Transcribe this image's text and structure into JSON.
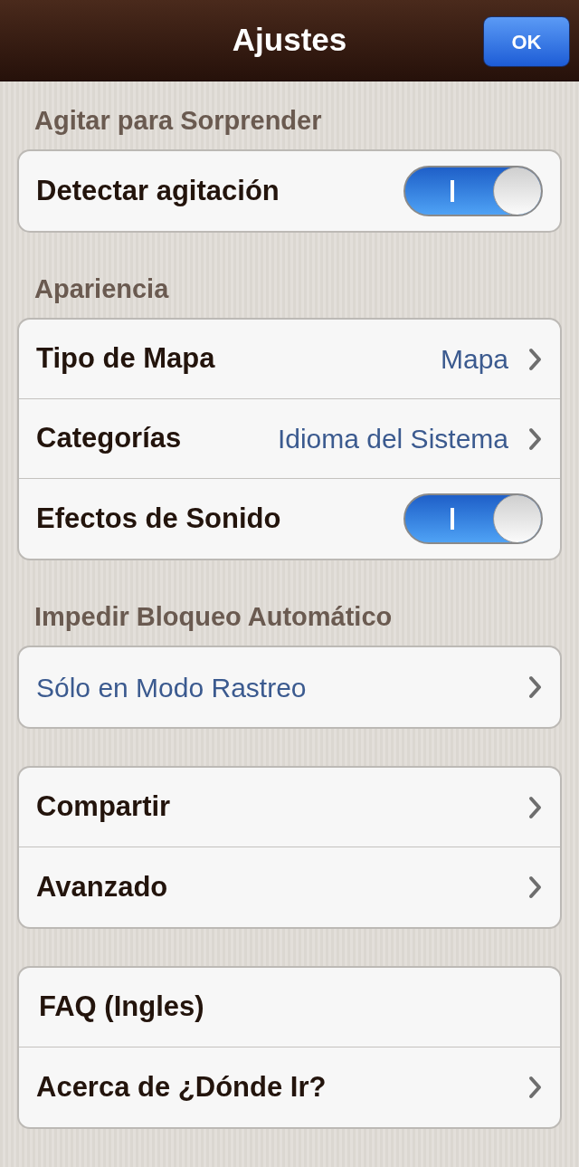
{
  "header": {
    "title": "Ajustes",
    "done_button": "OK"
  },
  "sections": [
    {
      "header": "Agitar para Sorprender",
      "rows": [
        {
          "kind": "toggle",
          "label": "Detectar agitación",
          "on": true
        }
      ]
    },
    {
      "header": "Apariencia",
      "rows": [
        {
          "kind": "value",
          "label": "Tipo de Mapa",
          "value": "Mapa"
        },
        {
          "kind": "value",
          "label": "Categorías",
          "value": "Idioma del Sistema"
        },
        {
          "kind": "toggle",
          "label": "Efectos de Sonido",
          "on": true
        }
      ]
    },
    {
      "header": "Impedir Bloqueo Automático",
      "rows": [
        {
          "kind": "choice",
          "label": "Sólo en Modo Rastreo"
        }
      ]
    },
    {
      "rows": [
        {
          "kind": "link",
          "label": "Compartir"
        },
        {
          "kind": "link",
          "label": "Avanzado"
        }
      ]
    },
    {
      "rows": [
        {
          "kind": "plain",
          "label": "FAQ (Ingles)"
        },
        {
          "kind": "link",
          "label": "Acerca de ¿Dónde Ir?"
        }
      ]
    }
  ]
}
